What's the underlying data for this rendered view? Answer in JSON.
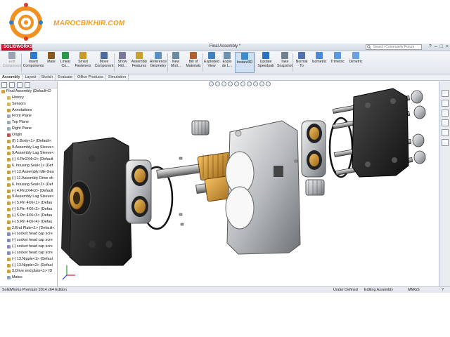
{
  "watermark": {
    "brand": "MAROCBIKHIR.COM",
    "brand_color": "#f0a020"
  },
  "titlebar": {
    "app_name": "SOLIDWORKS",
    "title": "Final Assembly *",
    "search_placeholder": "Search Community Forum",
    "controls": [
      "?",
      "–",
      "□",
      "×"
    ]
  },
  "ribbon": {
    "commands": [
      {
        "label1": "Edit",
        "label2": "Component",
        "icon": "edit-component-icon",
        "disabled": true
      },
      {
        "label1": "Insert",
        "label2": "Components",
        "icon": "insert-components-icon"
      },
      {
        "label1": "Mate",
        "label2": "",
        "icon": "mate-icon"
      },
      {
        "label1": "Linear",
        "label2": "Co...",
        "icon": "linear-pattern-icon"
      },
      {
        "label1": "Smart",
        "label2": "Fasteners",
        "icon": "smart-fasteners-icon"
      },
      {
        "label1": "Move",
        "label2": "Component",
        "icon": "move-component-icon"
      },
      {
        "label1": "Show",
        "label2": "Hid...",
        "icon": "show-hidden-icon"
      },
      {
        "label1": "Assembly",
        "label2": "Features",
        "icon": "assembly-features-icon"
      },
      {
        "label1": "Reference",
        "label2": "Geometry",
        "icon": "reference-geometry-icon"
      },
      {
        "label1": "New",
        "label2": "Moti...",
        "icon": "new-motion-study-icon"
      },
      {
        "label1": "Bill of",
        "label2": "Materials",
        "icon": "bill-of-materials-icon"
      },
      {
        "label1": "Exploded",
        "label2": "View",
        "icon": "exploded-view-icon"
      },
      {
        "label1": "Explo",
        "label2": "de L...",
        "icon": "explode-line-sketch-icon"
      },
      {
        "label1": "Instant3D",
        "label2": "",
        "icon": "instant3d-icon",
        "active": true
      },
      {
        "label1": "Update",
        "label2": "Speedpak",
        "icon": "update-speedpak-icon"
      },
      {
        "label1": "Take",
        "label2": "Snapshot",
        "icon": "take-snapshot-icon"
      },
      {
        "label1": "Normal",
        "label2": "To",
        "icon": "normal-to-icon"
      },
      {
        "label1": "Isometric",
        "label2": "",
        "icon": "isometric-icon"
      },
      {
        "label1": "Trimetric",
        "label2": "",
        "icon": "trimetric-icon"
      },
      {
        "label1": "Dimetric",
        "label2": "",
        "icon": "dimetric-icon"
      }
    ]
  },
  "tabs": [
    "Assembly",
    "Layout",
    "Sketch",
    "Evaluate",
    "Office Products",
    "Simulation"
  ],
  "tree": {
    "items": [
      {
        "label": "Final Assembly  (Default<D",
        "indent": 0,
        "color": "#d8a040"
      },
      {
        "label": "History",
        "indent": 1,
        "color": "#d8b860"
      },
      {
        "label": "Sensors",
        "indent": 1,
        "color": "#d8b860"
      },
      {
        "label": "Annotations",
        "indent": 1,
        "color": "#c8a040"
      },
      {
        "label": "Front Plane",
        "indent": 1,
        "color": "#9aa8b8"
      },
      {
        "label": "Top Plane",
        "indent": 1,
        "color": "#9aa8b8"
      },
      {
        "label": "Right Plane",
        "indent": 1,
        "color": "#9aa8b8"
      },
      {
        "label": "Origin",
        "indent": 1,
        "color": "#c05050"
      },
      {
        "label": "(f) 1.Body<1> (Default<",
        "indent": 1,
        "color": "#c8a040"
      },
      {
        "label": "9.Assembly Lag Sleeve<",
        "indent": 1,
        "color": "#c8a040"
      },
      {
        "label": "9.Assembly Lag Sleeve<",
        "indent": 1,
        "color": "#c8a040"
      },
      {
        "label": "(-) 4.Pin2X4<2> (Default",
        "indent": 1,
        "color": "#c8a040"
      },
      {
        "label": "6. housing Seal<1> (Def",
        "indent": 1,
        "color": "#c8a040"
      },
      {
        "label": "(-) 12.Assembly Idle Gea",
        "indent": 1,
        "color": "#c8a040"
      },
      {
        "label": "(-) 11.Assembly Drive sh",
        "indent": 1,
        "color": "#c8a040"
      },
      {
        "label": "6. housing Seal<2> (Def",
        "indent": 1,
        "color": "#c8a040"
      },
      {
        "label": "(-) 4.Pin2X4<2> (Default",
        "indent": 1,
        "color": "#c8a040"
      },
      {
        "label": "9.Assembly Lag Sleeve<",
        "indent": 1,
        "color": "#c8a040"
      },
      {
        "label": "(-) 5.Pin 4X6<1> (Defau",
        "indent": 1,
        "color": "#c8a040"
      },
      {
        "label": "(-) 5.Pin 4X6<2> (Defau",
        "indent": 1,
        "color": "#c8a040"
      },
      {
        "label": "(-) 5.Pin 4X6<3> (Defau",
        "indent": 1,
        "color": "#c8a040"
      },
      {
        "label": "(-) 5.Pin 4X6<4> (Defau",
        "indent": 1,
        "color": "#c8a040"
      },
      {
        "label": "2.End Plate<1> (Default<",
        "indent": 1,
        "color": "#c8a040"
      },
      {
        "label": "(-) socket head cap scre",
        "indent": 1,
        "color": "#8888c0"
      },
      {
        "label": "(-) socket head cap scre",
        "indent": 1,
        "color": "#8888c0"
      },
      {
        "label": "(-) socket head cap scre",
        "indent": 1,
        "color": "#8888c0"
      },
      {
        "label": "(-) socket head cap scre",
        "indent": 1,
        "color": "#8888c0"
      },
      {
        "label": "(-) 13.Nipple<1> (Defaul",
        "indent": 1,
        "color": "#c8a040"
      },
      {
        "label": "(-) 13.Nipple<2> (Defaul",
        "indent": 1,
        "color": "#c8a040"
      },
      {
        "label": "3.Drive end plate<1> (D",
        "indent": 1,
        "color": "#c8a040"
      },
      {
        "label": "Mates",
        "indent": 1,
        "color": "#8aa0b8"
      }
    ]
  },
  "status": {
    "left": "SolidWorks Premium 2014 x64 Edition",
    "state": "Under Defined",
    "mode": "Editing Assembly",
    "units": "MMGS",
    "help": "?"
  }
}
